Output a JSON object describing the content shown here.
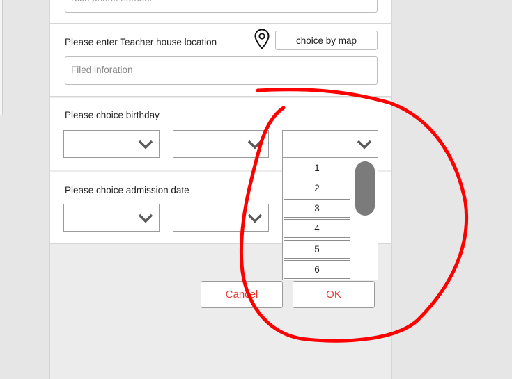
{
  "form": {
    "kids_phone": {
      "placeholder": "Kids phone number"
    },
    "teacher_location": {
      "label": "Please enter Teacher house location",
      "map_button": "choice by map",
      "placeholder": "Filed inforation",
      "icon": "location-pin-icon"
    },
    "birthday": {
      "label": "Please choice birthday",
      "selects": [
        {
          "value": ""
        },
        {
          "value": ""
        },
        {
          "value": ""
        }
      ],
      "open_dropdown_options": [
        "1",
        "2",
        "3",
        "4",
        "5",
        "6"
      ]
    },
    "admission_date": {
      "label": "Please choice admission date",
      "selects": [
        {
          "value": ""
        },
        {
          "value": ""
        }
      ]
    }
  },
  "actions": {
    "cancel_label": "Cancel",
    "ok_label": "OK"
  },
  "colors": {
    "accent": "#e53935",
    "annotation": "#ff0000",
    "background": "#e6e6e6"
  },
  "annotation": {
    "type": "hand-drawn red circle around the open dropdown and OK button"
  }
}
